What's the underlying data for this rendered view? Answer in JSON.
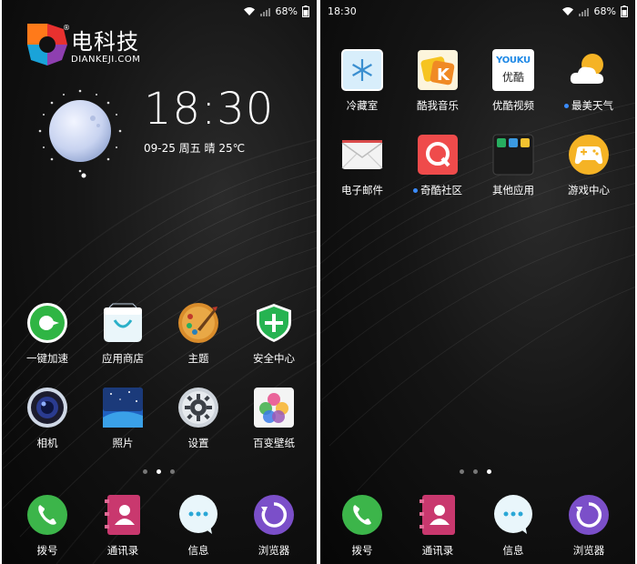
{
  "left_screen": {
    "status": {
      "battery": "68%"
    },
    "logo": {
      "cn": "电科技",
      "en": "DIANKEJI.COM",
      "reg": "®"
    },
    "clock": {
      "time": "18:30",
      "date": "09-25 周五 晴 25℃"
    },
    "apps": [
      {
        "label": "一键加速",
        "icon": "speed-boost-icon"
      },
      {
        "label": "应用商店",
        "icon": "app-store-icon"
      },
      {
        "label": "主题",
        "icon": "theme-palette-icon"
      },
      {
        "label": "安全中心",
        "icon": "security-shield-icon"
      },
      {
        "label": "相机",
        "icon": "camera-icon"
      },
      {
        "label": "照片",
        "icon": "photos-icon"
      },
      {
        "label": "设置",
        "icon": "settings-gear-icon"
      },
      {
        "label": "百变壁纸",
        "icon": "wallpaper-icon"
      }
    ],
    "pager": {
      "count": 3,
      "active": 2
    },
    "dock": [
      {
        "label": "拨号",
        "icon": "phone-icon"
      },
      {
        "label": "通讯录",
        "icon": "contacts-icon"
      },
      {
        "label": "信息",
        "icon": "messages-icon"
      },
      {
        "label": "浏览器",
        "icon": "browser-icon"
      }
    ]
  },
  "right_screen": {
    "status": {
      "time": "18:30",
      "battery": "68%"
    },
    "apps": [
      {
        "label": "冷藏室",
        "icon": "freezer-icon",
        "new": false
      },
      {
        "label": "酷我音乐",
        "icon": "kuwo-music-icon",
        "new": false
      },
      {
        "label": "优酷视频",
        "icon": "youku-video-icon",
        "new": false,
        "icon_text_top": "YOUKU",
        "icon_text_bottom": "优酷"
      },
      {
        "label": "最美天气",
        "icon": "weather-icon",
        "new": true
      },
      {
        "label": "电子邮件",
        "icon": "email-icon",
        "new": false
      },
      {
        "label": "奇酷社区",
        "icon": "qiku-community-icon",
        "new": true
      },
      {
        "label": "其他应用",
        "icon": "other-apps-folder-icon",
        "new": false
      },
      {
        "label": "游戏中心",
        "icon": "game-center-icon",
        "new": false
      }
    ],
    "pager": {
      "count": 3,
      "active": 3
    },
    "dock": [
      {
        "label": "拨号",
        "icon": "phone-icon"
      },
      {
        "label": "通讯录",
        "icon": "contacts-icon"
      },
      {
        "label": "信息",
        "icon": "messages-icon"
      },
      {
        "label": "浏览器",
        "icon": "browser-icon"
      }
    ]
  },
  "colors": {
    "accent_dot": "#3b8cff",
    "wallpaper": "#0b0b0b"
  }
}
